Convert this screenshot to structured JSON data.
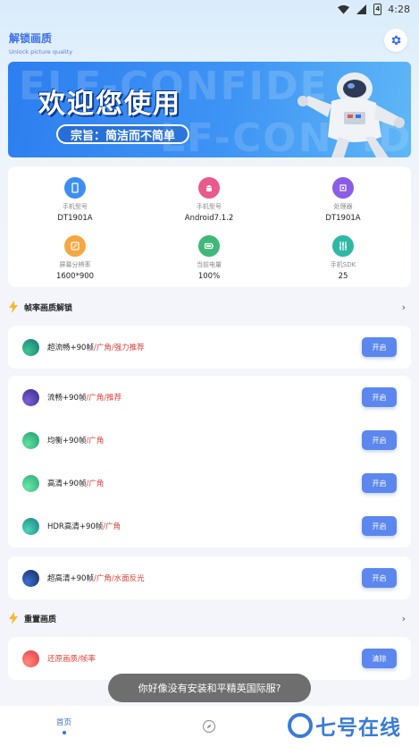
{
  "status_bar": {
    "time": "4:28",
    "battery_text": "4"
  },
  "app": {
    "title": "解锁画质",
    "subtitle": "Unlock picture quality"
  },
  "banner": {
    "title": "欢迎您使用",
    "slogan": "宗旨：简洁而不简单",
    "bg_text_1": "ELF-CONFIDE",
    "bg_text_2": "LF-CONFIDEN"
  },
  "device_info": [
    {
      "label": "手机型号",
      "value": "DT1901A",
      "icon": "phone-icon",
      "color": "#3d8ef0"
    },
    {
      "label": "手机型号",
      "value": "Android7.1.2",
      "icon": "android-icon",
      "color": "#ea5a8c"
    },
    {
      "label": "处理器",
      "value": "DT1901A",
      "icon": "cpu-icon",
      "color": "#8b5ce6"
    },
    {
      "label": "屏幕分辨率",
      "value": "1600*900",
      "icon": "screen-icon",
      "color": "#f5a742"
    },
    {
      "label": "当前电量",
      "value": "100%",
      "icon": "battery-icon",
      "color": "#3fb979"
    },
    {
      "label": "手机SDK",
      "value": "25",
      "icon": "sliders-icon",
      "color": "#2fb7a5"
    }
  ],
  "sections": {
    "fps_title": "帧率画质解锁",
    "reset_title": "重置画质"
  },
  "fps_options_group1": [
    {
      "name": "超流畅+90帧",
      "tag": "/广角/强力推荐",
      "button": "开启",
      "dot_color": "#1fa08c"
    }
  ],
  "fps_options_group2": [
    {
      "name": "流畅+90帧",
      "tag": "/广角/推荐",
      "button": "开启",
      "dot_color": "#5b3fb0"
    },
    {
      "name": "均衡+90帧",
      "tag": "/广角",
      "button": "开启",
      "dot_color": "#2fbf7a"
    },
    {
      "name": "高清+90帧",
      "tag": "/广角",
      "button": "开启",
      "dot_color": "#2fbf8a"
    },
    {
      "name": "HDR高清+90帧",
      "tag": "/广角",
      "button": "开启",
      "dot_color": "#22a8a0"
    }
  ],
  "fps_options_group3": [
    {
      "name": "超高清+90帧",
      "tag": "/广角/水面反光",
      "button": "开启",
      "dot_color": "#23468f"
    }
  ],
  "reset_options": [
    {
      "name": "",
      "tag": "还原画质/帧率",
      "button": "清除",
      "dot_color": "#f0565a"
    }
  ],
  "toast": "你好像没有安装和平精英国际服?",
  "bottom_nav": {
    "home_label": "首页"
  },
  "watermark": "七号在线"
}
